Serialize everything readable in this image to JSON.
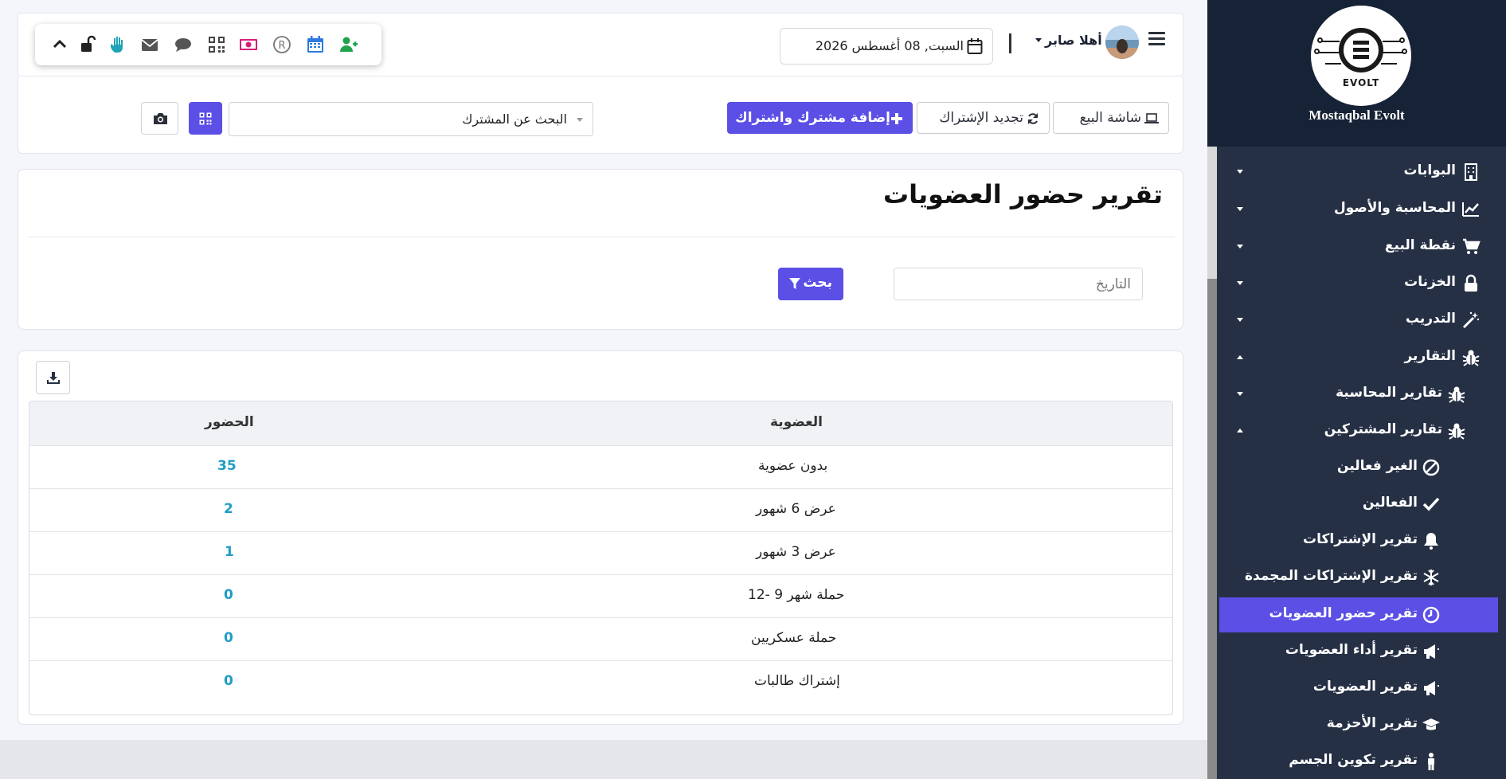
{
  "sidebar": {
    "brand_name": "Mostaqbal Evolt",
    "logo_text": "EVOLT",
    "items": [
      {
        "label": "البوابات",
        "icon": "building-icon"
      },
      {
        "label": "المحاسبة والأصول",
        "icon": "chart-line-icon"
      },
      {
        "label": "نقطة البيع",
        "icon": "cart-icon"
      },
      {
        "label": "الخزنات",
        "icon": "lock-icon"
      },
      {
        "label": "التدريب",
        "icon": "magic-wand-icon"
      },
      {
        "label": "التقارير",
        "icon": "bug-icon"
      },
      {
        "label": "تقارير المحاسبة",
        "icon": "bug-icon"
      },
      {
        "label": "تقارير المشتركين",
        "icon": "bug-icon"
      },
      {
        "label": "الغير فعالين",
        "icon": "ban-icon"
      },
      {
        "label": "الفعالين",
        "icon": "check-icon"
      },
      {
        "label": "تقرير الإشتراكات",
        "icon": "bell-icon"
      },
      {
        "label": "تقرير الإشتراكات المجمدة",
        "icon": "snowflake-icon"
      },
      {
        "label": "تقرير حضور العضويات",
        "icon": "clock-icon"
      },
      {
        "label": "تقرير أداء العضويات",
        "icon": "bullhorn-icon"
      },
      {
        "label": "تقرير العضويات",
        "icon": "bullhorn-icon"
      },
      {
        "label": "تقرير الأحزمة",
        "icon": "graduation-cap-icon"
      },
      {
        "label": "تقرير تكوين الجسم",
        "icon": "person-icon"
      }
    ]
  },
  "header": {
    "user_greeting": "أهلا صابر",
    "date": "السبت, 08 أغسطس 2026"
  },
  "toolbar": {
    "pos_screen": "شاشة البيع",
    "renew_subscription": "تجديد الإشتراك",
    "add_member": "إضافة مشترك واشتراك",
    "member_search_placeholder": "البحث عن المشترك"
  },
  "report": {
    "title": "تقرير حضور العضويات",
    "date_placeholder": "التاريخ",
    "search_label": "بحث"
  },
  "table": {
    "columns": [
      "العضوية",
      "الحضور"
    ],
    "rows": [
      {
        "membership": "بدون عضوية",
        "attendance": "35"
      },
      {
        "membership": "عرض 6 شهور",
        "attendance": "2"
      },
      {
        "membership": "عرض 3 شهور",
        "attendance": "1"
      },
      {
        "membership": "حملة شهر 9 -12",
        "attendance": "0"
      },
      {
        "membership": "حملة عسكريين",
        "attendance": "0"
      },
      {
        "membership": "إشتراك طالبات",
        "attendance": "0"
      }
    ]
  },
  "colors": {
    "accent": "#5b4fe6",
    "sidebar_bg": "#263045",
    "number_blue": "#1f9cc5"
  }
}
